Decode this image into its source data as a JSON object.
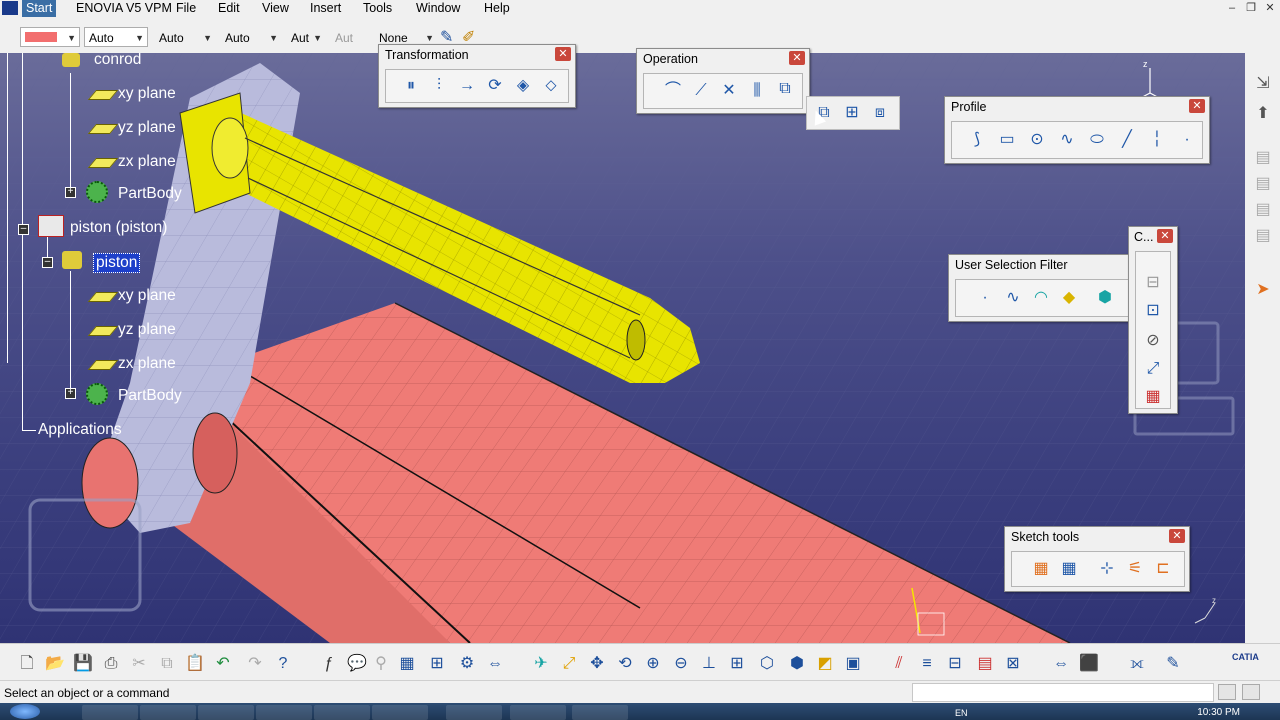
{
  "menu": {
    "start": "Start",
    "items": [
      "ENOVIA V5 VPM",
      "File",
      "Edit",
      "View",
      "Insert",
      "Tools",
      "Window",
      "Help"
    ]
  },
  "graphic_props": {
    "color_swatch": "#f26e6e",
    "combo1": "Auto",
    "combo2": "Auto",
    "combo3": "Auto",
    "combo4": "Aut",
    "combo5": "Aut",
    "combo6": "None"
  },
  "tree": {
    "conrod": "conrod",
    "conrod_xy": "xy plane",
    "conrod_yz": "yz plane",
    "conrod_zx": "zx plane",
    "conrod_body": "PartBody",
    "piston_product": "piston (piston)",
    "piston_part": "piston",
    "piston_xy": "xy plane",
    "piston_yz": "yz plane",
    "piston_zx": "zx plane",
    "piston_body": "PartBody",
    "applications": "Applications"
  },
  "panels": {
    "transformation": "Transformation",
    "operation": "Operation",
    "profile": "Profile",
    "user_selection_filter": "User Selection Filter",
    "constraint": "C...",
    "sketch_tools": "Sketch tools"
  },
  "status": {
    "message": "Select an object or a command"
  },
  "taskbar": {
    "lang": "EN",
    "time": "10:30 PM"
  },
  "colors": {
    "conrod": "#e8e400",
    "piston": "#ef7b76",
    "highlight": "#1d3fc9"
  },
  "icons": {
    "transformation": [
      "symmetry-icon",
      "mirror-icon",
      "translate-icon",
      "rotate-icon",
      "scale-icon",
      "offset-icon"
    ],
    "operation": [
      "corner-icon",
      "chamfer-icon",
      "trim-icon",
      "mirror-op-icon",
      "project-3d-icon"
    ],
    "operation_sub": [
      "project-3d-elements-icon",
      "intersect-3d-icon",
      "project-silhouette-icon"
    ],
    "profile": [
      "profile-icon",
      "rectangle-icon",
      "circle-icon",
      "spline-icon",
      "ellipse-icon",
      "line-icon",
      "axis-icon",
      "point-icon"
    ],
    "selection_filter": [
      "point-filter-icon",
      "curve-filter-icon",
      "surface-filter-icon",
      "volume-filter-icon",
      "feature-filter-icon"
    ],
    "constraint": [
      "constraint-icon",
      "constraint-box-icon",
      "fix-together-icon",
      "auto-constraint-icon",
      "animate-constraint-icon"
    ],
    "sketch_tools": [
      "grid-icon",
      "snap-to-point-icon",
      "construction-element-icon",
      "geometrical-constraints-icon",
      "dimensional-constraints-icon"
    ]
  }
}
